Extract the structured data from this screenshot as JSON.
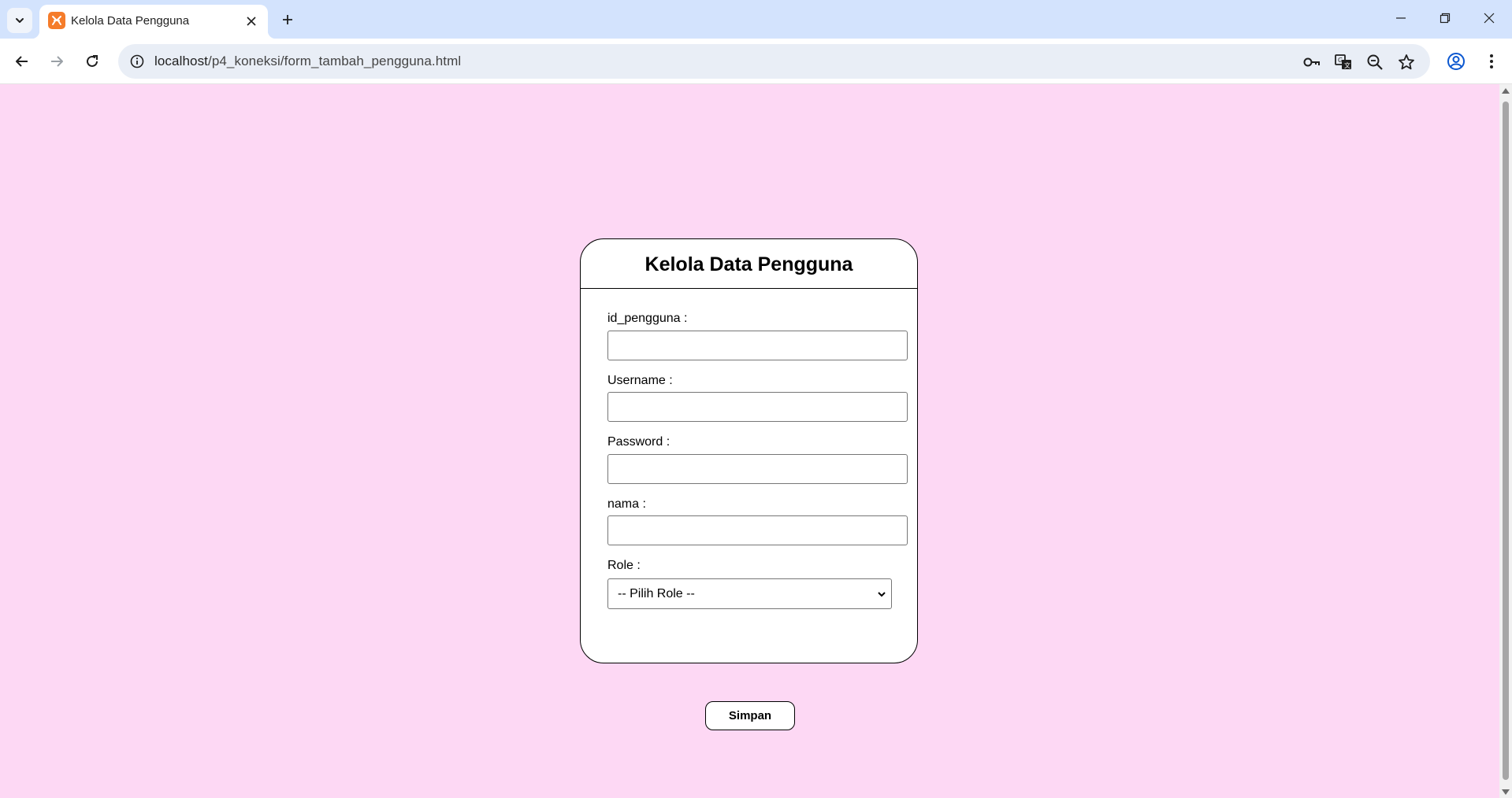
{
  "browser": {
    "tab": {
      "title": "Kelola Data Pengguna"
    },
    "address_bar": {
      "host": "localhost",
      "path": "/p4_koneksi/form_tambah_pengguna.html"
    }
  },
  "form": {
    "title": "Kelola Data Pengguna",
    "fields": [
      {
        "label": "id_pengguna :",
        "value": ""
      },
      {
        "label": "Username :",
        "value": ""
      },
      {
        "label": "Password :",
        "value": ""
      },
      {
        "label": "nama :",
        "value": ""
      }
    ],
    "role": {
      "label": "Role :",
      "selected": "-- Pilih Role --"
    },
    "submit_label": "Simpan"
  },
  "colors": {
    "page_background": "#fdd8f4",
    "tabbar_background": "#d3e3fd",
    "favicon": "#f57c2a"
  }
}
